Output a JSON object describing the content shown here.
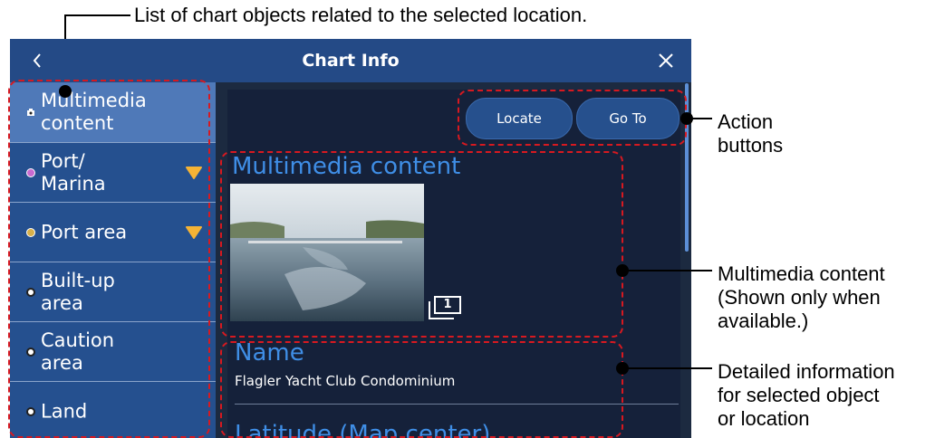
{
  "annotations": {
    "top": "List of chart objects related to the selected location.",
    "action_buttons": [
      "Action",
      "buttons"
    ],
    "multimedia": [
      "Multimedia content",
      "(Shown only when",
      "available.)"
    ],
    "details": [
      "Detailed information",
      "for selected object",
      "or location"
    ]
  },
  "window": {
    "title": "Chart Info",
    "back_icon": "chevron-left-icon",
    "close_icon": "close-icon"
  },
  "sidebar": {
    "items": [
      {
        "lines": [
          "Multimedia",
          "content"
        ],
        "icon": "camera-icon",
        "selected": true
      },
      {
        "lines": [
          "Port/",
          "Marina"
        ],
        "icon": "marina-icon",
        "expand": true
      },
      {
        "lines": [
          "Port area"
        ],
        "icon": "port-area-icon",
        "expand": true
      },
      {
        "lines": [
          "Built-up",
          "area"
        ],
        "icon": "dot-icon"
      },
      {
        "lines": [
          "Caution",
          "area"
        ],
        "icon": "dot-icon"
      },
      {
        "lines": [
          "Land"
        ],
        "icon": "dot-icon"
      }
    ]
  },
  "actions": {
    "locate_label": "Locate",
    "goto_label": "Go To"
  },
  "multimedia": {
    "title": "Multimedia content",
    "count": "1"
  },
  "details": {
    "name_label": "Name",
    "name_value": "Flagler Yacht Club Condominium",
    "next_label": "Latitude (Map center)"
  },
  "colors": {
    "accent": "#3f8ee6",
    "titlebar": "#244a86",
    "sidebar": "#25508f",
    "selected": "#4f79b8",
    "expand_arrow": "#f5b335",
    "highlight": "#d71920"
  }
}
